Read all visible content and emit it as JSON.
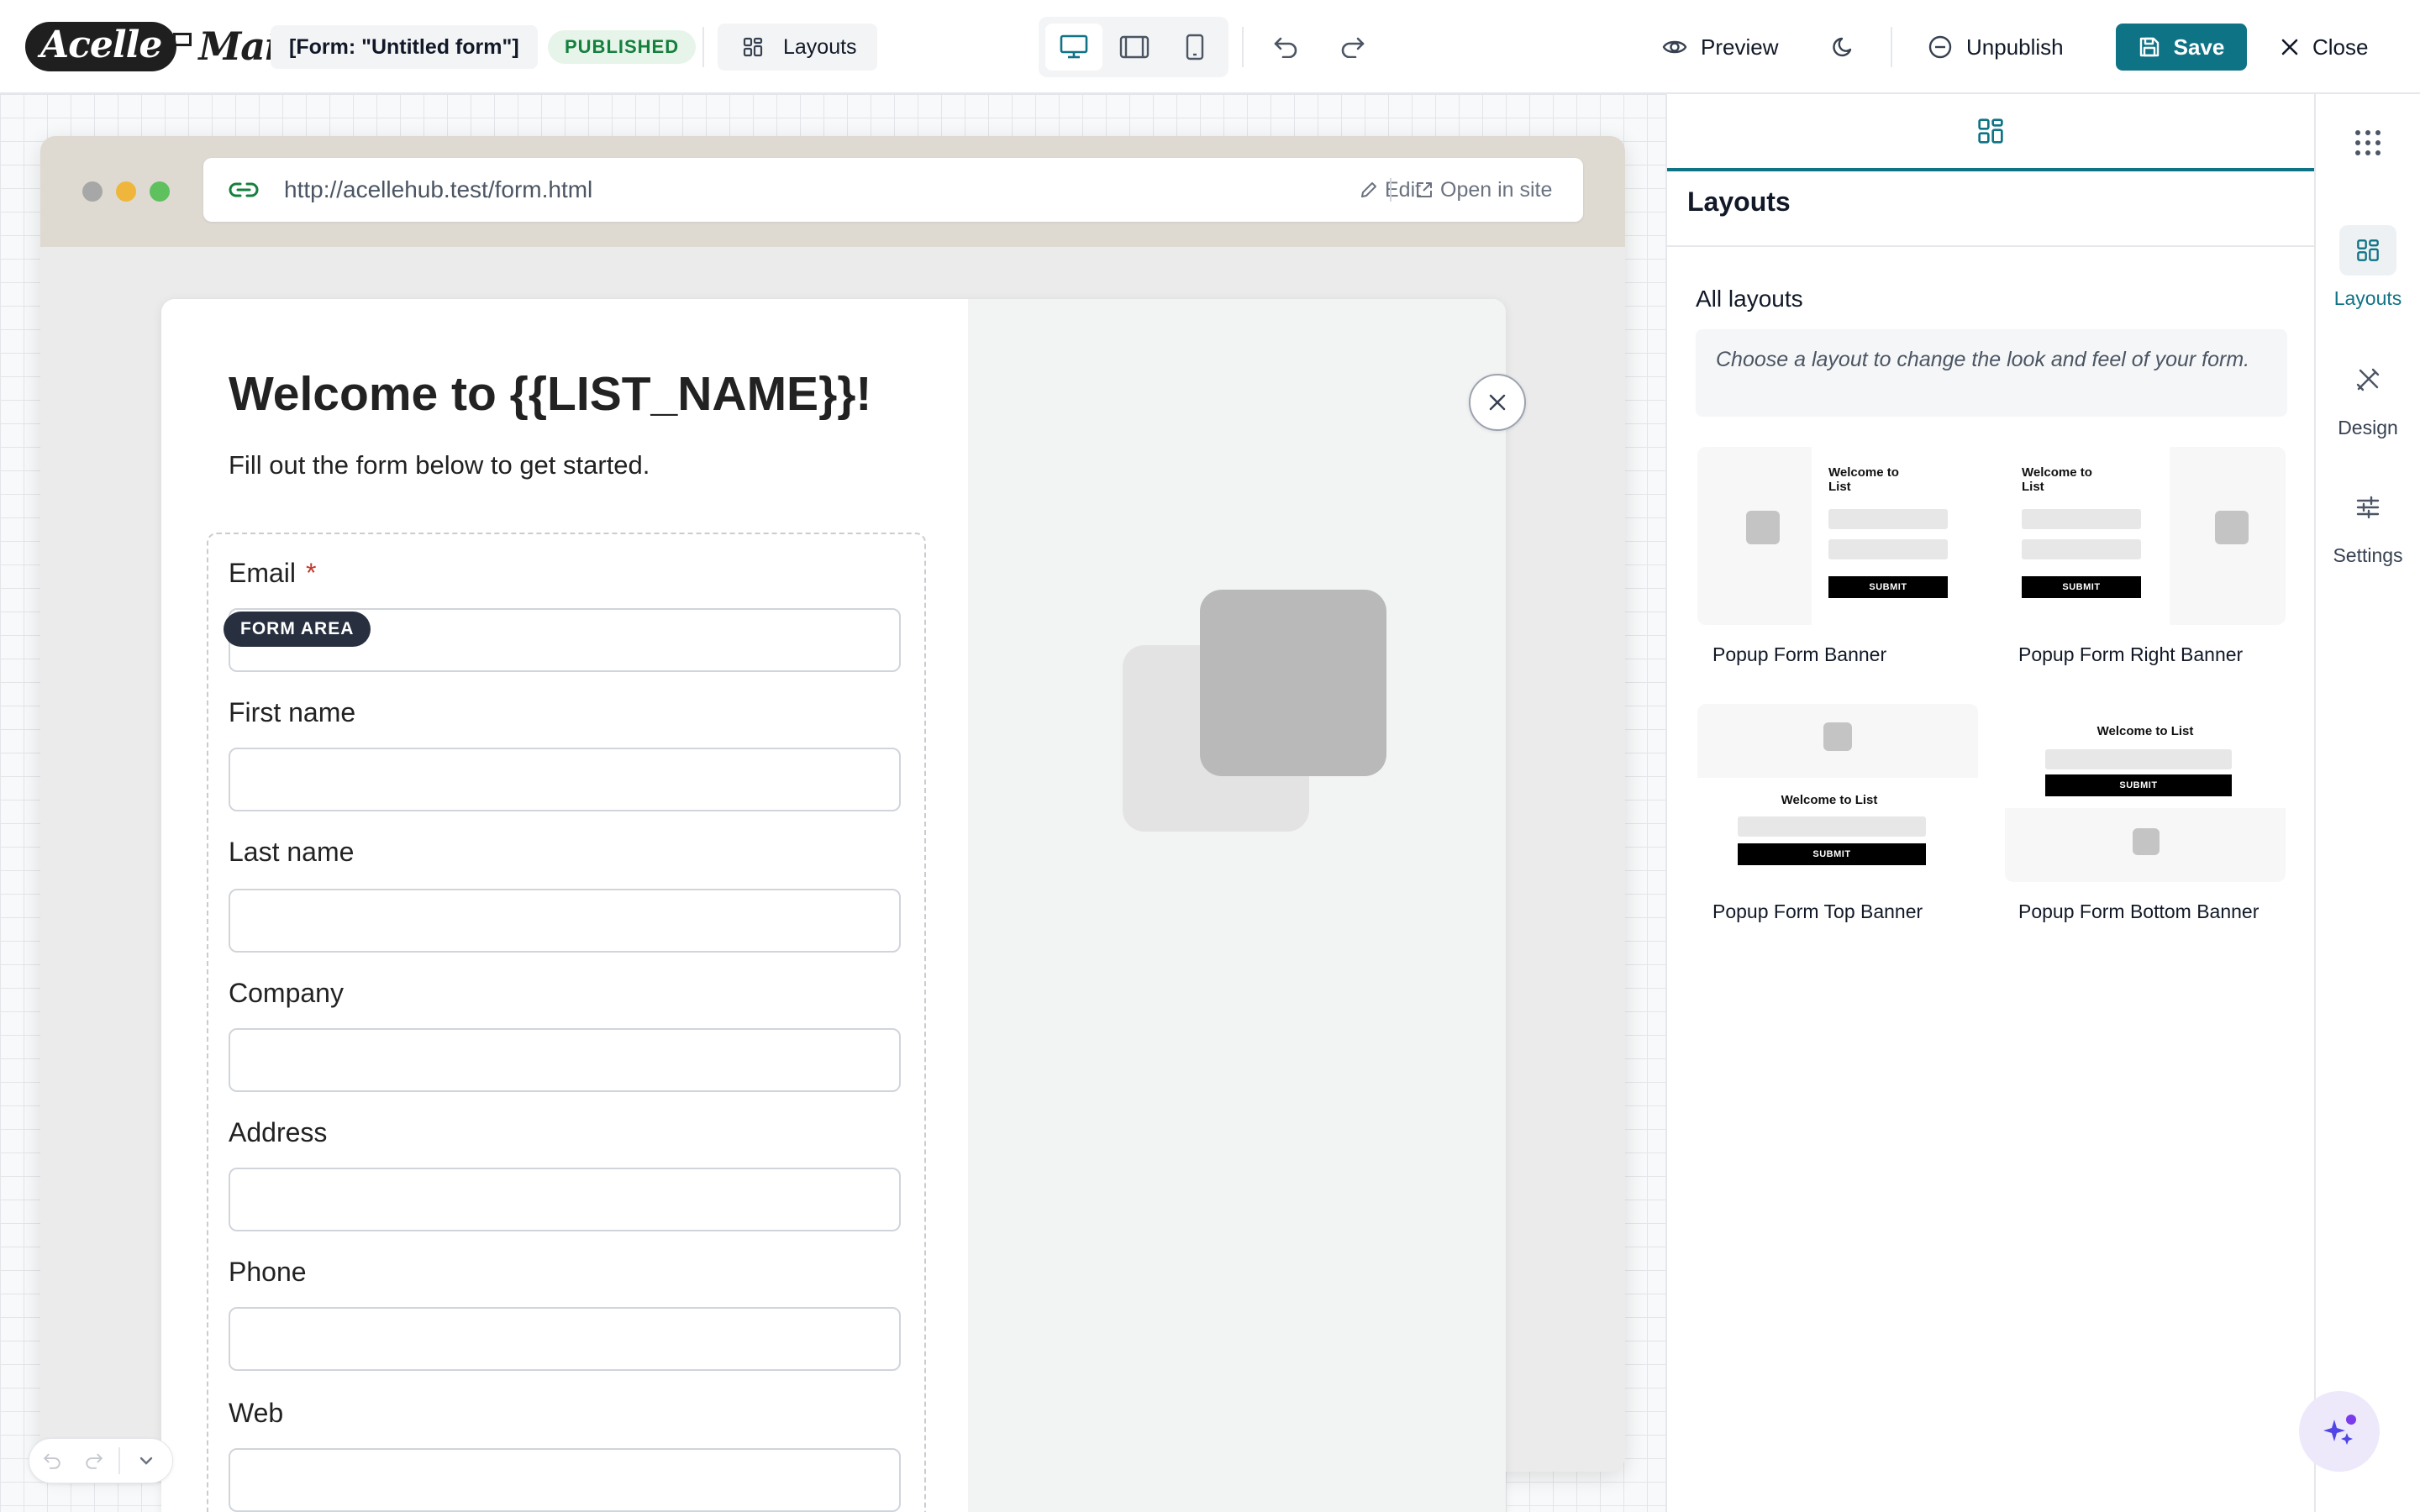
{
  "header": {
    "logo_part1": "Acelle",
    "logo_part2": "Mail",
    "form_name": "[Form: \"Untitled form\"]",
    "status_badge": "PUBLISHED",
    "layouts_label": "Layouts",
    "preview_label": "Preview",
    "unpublish_label": "Unpublish",
    "save_label": "Save",
    "close_label": "Close",
    "active_device": "desktop",
    "accent_color": "#0f7386"
  },
  "browser": {
    "url": "http://acellehub.test/form.html",
    "edit_label": "Edit",
    "open_label": "Open in site"
  },
  "form": {
    "title": "Welcome to {{LIST_NAME}}!",
    "subtitle": "Fill out the form below to get started.",
    "area_badge": "FORM AREA",
    "fields": [
      {
        "label": "Email",
        "required": true,
        "value": ""
      },
      {
        "label": "First name",
        "required": false,
        "value": ""
      },
      {
        "label": "Last name",
        "required": false,
        "value": ""
      },
      {
        "label": "Company",
        "required": false,
        "value": ""
      },
      {
        "label": "Address",
        "required": false,
        "value": ""
      },
      {
        "label": "Phone",
        "required": false,
        "value": ""
      },
      {
        "label": "Web",
        "required": false,
        "value": ""
      }
    ],
    "required_mark": "*"
  },
  "panel": {
    "title": "Layouts",
    "section_title": "All layouts",
    "hint": "Choose a layout to change the look and feel of your form.",
    "layouts": [
      {
        "name": "Popup Form Banner",
        "thumb_title": "Welcome to List",
        "thumb_submit": "SUBMIT"
      },
      {
        "name": "Popup Form Right Banner",
        "thumb_title": "Welcome to List",
        "thumb_submit": "SUBMIT"
      },
      {
        "name": "Popup Form Top Banner",
        "thumb_title": "Welcome to List",
        "thumb_submit": "SUBMIT"
      },
      {
        "name": "Popup Form Bottom Banner",
        "thumb_title": "Welcome to List",
        "thumb_submit": "SUBMIT"
      }
    ]
  },
  "sidebar": {
    "items": [
      {
        "label": "Layouts",
        "icon": "layouts-icon",
        "active": true
      },
      {
        "label": "Design",
        "icon": "design-icon",
        "active": false
      },
      {
        "label": "Settings",
        "icon": "settings-sliders-icon",
        "active": false
      }
    ]
  }
}
